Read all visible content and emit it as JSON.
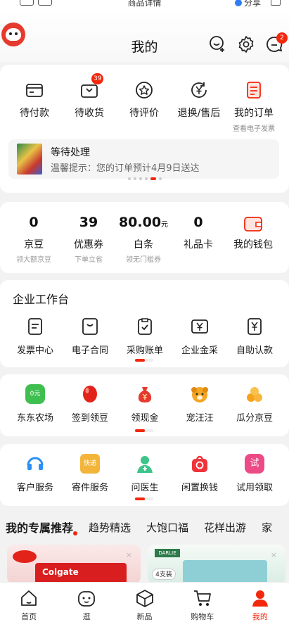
{
  "status_bar": {
    "title": "商品详情",
    "share": "分享"
  },
  "header": {
    "title": "我的",
    "message_badge": "2"
  },
  "orders": {
    "items": [
      {
        "label": "待付款",
        "icon": "wallet-card-icon"
      },
      {
        "label": "待收货",
        "icon": "delivery-box-icon",
        "badge": "39"
      },
      {
        "label": "待评价",
        "icon": "review-star-icon"
      },
      {
        "label": "退换/售后",
        "icon": "refund-yen-icon"
      },
      {
        "label": "我的订单",
        "icon": "order-list-icon",
        "sub": "查看电子发票"
      }
    ],
    "pending": {
      "title": "等待处理",
      "tip": "温馨提示：您的订单预计4月9日送达"
    }
  },
  "wallet": {
    "items": [
      {
        "value": "0",
        "unit": "",
        "label": "京豆",
        "sub": "领大额京豆"
      },
      {
        "value": "39",
        "unit": "",
        "label": "优惠券",
        "sub": "下单立省"
      },
      {
        "value": "80.00",
        "unit": "元",
        "label": "白条",
        "sub": "领无门槛券"
      },
      {
        "value": "0",
        "unit": "",
        "label": "礼品卡",
        "sub": ""
      },
      {
        "value": "",
        "unit": "",
        "label": "我的钱包",
        "sub": ""
      }
    ]
  },
  "enterprise": {
    "title": "企业工作台",
    "items": [
      {
        "label": "发票中心"
      },
      {
        "label": "电子合同"
      },
      {
        "label": "采购账单"
      },
      {
        "label": "企业金采"
      },
      {
        "label": "自助认款"
      }
    ]
  },
  "fun": {
    "items": [
      {
        "label": "东东农场",
        "tag": "0元"
      },
      {
        "label": "签到领豆"
      },
      {
        "label": "领现金"
      },
      {
        "label": "宠汪汪"
      },
      {
        "label": "瓜分京豆"
      }
    ]
  },
  "services": {
    "items": [
      {
        "label": "客户服务"
      },
      {
        "label": "寄件服务",
        "tag": "快递"
      },
      {
        "label": "问医生"
      },
      {
        "label": "闲置换钱"
      },
      {
        "label": "试用领取",
        "tag": "试"
      }
    ]
  },
  "recommend": {
    "tabs": [
      "我的专属推荐",
      "趋势精选",
      "大饱口福",
      "花样出游",
      "家"
    ],
    "products": [
      {
        "brand": "Colgate",
        "close": "×"
      },
      {
        "brand": "DARLIE",
        "tag": "4支装",
        "close": "×"
      }
    ]
  },
  "bottom_nav": {
    "items": [
      {
        "label": "首页"
      },
      {
        "label": "逛"
      },
      {
        "label": "新品"
      },
      {
        "label": "购物车"
      },
      {
        "label": "我的"
      }
    ]
  },
  "colors": {
    "accent": "#f2270c",
    "avatar": "#e63a2e"
  }
}
